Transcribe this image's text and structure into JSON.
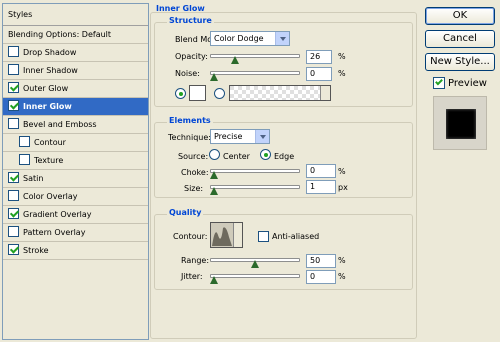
{
  "styles": {
    "header": "Styles",
    "items": [
      {
        "label": "Blending Options: Default",
        "checkbox": false,
        "checked": false
      },
      {
        "label": "Drop Shadow",
        "checkbox": true,
        "checked": false
      },
      {
        "label": "Inner Shadow",
        "checkbox": true,
        "checked": false
      },
      {
        "label": "Outer Glow",
        "checkbox": true,
        "checked": true
      },
      {
        "label": "Inner Glow",
        "checkbox": true,
        "checked": true,
        "selected": true
      },
      {
        "label": "Bevel and Emboss",
        "checkbox": true,
        "checked": false
      },
      {
        "label": "Contour",
        "checkbox": true,
        "checked": false,
        "indent": true
      },
      {
        "label": "Texture",
        "checkbox": true,
        "checked": false,
        "indent": true
      },
      {
        "label": "Satin",
        "checkbox": true,
        "checked": true
      },
      {
        "label": "Color Overlay",
        "checkbox": true,
        "checked": false
      },
      {
        "label": "Gradient Overlay",
        "checkbox": true,
        "checked": true
      },
      {
        "label": "Pattern Overlay",
        "checkbox": true,
        "checked": false
      },
      {
        "label": "Stroke",
        "checkbox": true,
        "checked": true
      }
    ]
  },
  "panel": {
    "title": "Inner Glow",
    "structure": {
      "title": "Structure",
      "blend_mode_label": "Blend Mode:",
      "blend_mode_value": "Color Dodge",
      "opacity_label": "Opacity:",
      "opacity_value": "26",
      "opacity_level": 26,
      "noise_label": "Noise:",
      "noise_value": "0",
      "noise_level": 0,
      "unit": "%"
    },
    "elements": {
      "title": "Elements",
      "technique_label": "Technique:",
      "technique_value": "Precise",
      "source_label": "Source:",
      "source_center": "Center",
      "source_edge": "Edge",
      "source_selected": "Edge",
      "choke_label": "Choke:",
      "choke_value": "0",
      "choke_level": 0,
      "choke_unit": "%",
      "size_label": "Size:",
      "size_value": "1",
      "size_level": 0,
      "size_unit": "px"
    },
    "quality": {
      "title": "Quality",
      "contour_label": "Contour:",
      "anti_aliased_label": "Anti-aliased",
      "anti_aliased_checked": false,
      "range_label": "Range:",
      "range_value": "50",
      "range_level": 50,
      "range_unit": "%",
      "jitter_label": "Jitter:",
      "jitter_value": "0",
      "jitter_level": 0,
      "jitter_unit": "%"
    }
  },
  "buttons": {
    "ok": "OK",
    "cancel": "Cancel",
    "new_style": "New Style...",
    "preview_label": "Preview",
    "preview_checked": true
  },
  "colors": {
    "selection": "#316ac5",
    "group_title": "#0046d5",
    "check": "#21a121"
  }
}
